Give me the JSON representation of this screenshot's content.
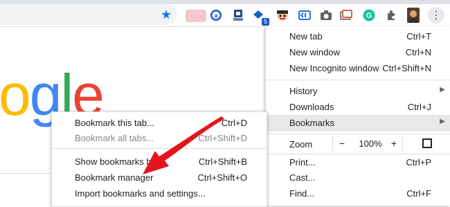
{
  "colors": {
    "accent": "#1a73e8",
    "arrow": "#e3141e",
    "highlight": "#e8e8e8"
  },
  "toolbar": {
    "icons": [
      "bookmark-star-icon",
      "blurred-extension-icon",
      "alexa-icon",
      "extension-icon-2",
      "extension-icon-3",
      "extension-icon-4",
      "extension-icon-5",
      "camera-icon",
      "extension-icon-6",
      "grammarly-icon",
      "puzzle-icon",
      "profile-avatar-icon",
      "more-menu-icon"
    ],
    "badge_count": "5"
  },
  "logo": {
    "letters": [
      "o",
      "g",
      "l",
      "e"
    ],
    "colors": [
      "#fbbc05",
      "#4285f4",
      "#34a853",
      "#ea4335"
    ]
  },
  "menu": {
    "new_tab": {
      "label": "New tab",
      "shortcut": "Ctrl+T"
    },
    "new_window": {
      "label": "New window",
      "shortcut": "Ctrl+N"
    },
    "incognito": {
      "label": "New Incognito window",
      "shortcut": "Ctrl+Shift+N"
    },
    "history": {
      "label": "History"
    },
    "downloads": {
      "label": "Downloads",
      "shortcut": "Ctrl+J"
    },
    "bookmarks": {
      "label": "Bookmarks"
    },
    "zoom": {
      "label": "Zoom",
      "minus": "−",
      "value": "100%",
      "plus": "+"
    },
    "print": {
      "label": "Print...",
      "shortcut": "Ctrl+P"
    },
    "cast": {
      "label": "Cast..."
    },
    "find": {
      "label": "Find...",
      "shortcut": "Ctrl+F"
    }
  },
  "submenu": {
    "bookmark_tab": {
      "label": "Bookmark this tab...",
      "shortcut": "Ctrl+D"
    },
    "bookmark_all": {
      "label": "Bookmark all tabs...",
      "shortcut": "Ctrl+Shift+D"
    },
    "show_bar": {
      "label": "Show bookmarks bar",
      "shortcut": "Ctrl+Shift+B"
    },
    "manager": {
      "label": "Bookmark manager",
      "shortcut": "Ctrl+Shift+O"
    },
    "import": {
      "label": "Import bookmarks and settings..."
    }
  }
}
